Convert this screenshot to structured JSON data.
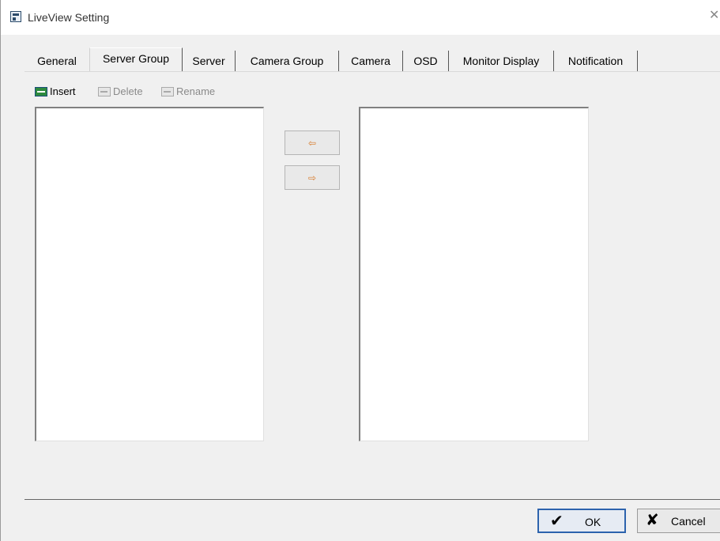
{
  "window": {
    "title": "LiveView Setting"
  },
  "tabs": [
    {
      "label": "General"
    },
    {
      "label": "Server Group",
      "active": true
    },
    {
      "label": "Server"
    },
    {
      "label": "Camera Group"
    },
    {
      "label": "Camera"
    },
    {
      "label": "OSD"
    },
    {
      "label": "Monitor Display"
    },
    {
      "label": "Notification"
    }
  ],
  "toolbar": {
    "insert": {
      "label": "Insert",
      "icon": "insert-icon",
      "enabled": true
    },
    "delete": {
      "label": "Delete",
      "icon": "delete-icon",
      "enabled": false
    },
    "rename": {
      "label": "Rename",
      "icon": "rename-icon",
      "enabled": false
    }
  },
  "transfer": {
    "move_left": {
      "icon": "arrow-left-icon"
    },
    "move_right": {
      "icon": "arrow-right-icon"
    }
  },
  "left_list": {
    "items": []
  },
  "right_list": {
    "items": []
  },
  "footer": {
    "ok_label": "OK",
    "cancel_label": "Cancel"
  },
  "colors": {
    "accent": "#2d63ad",
    "arrow": "#d77b2b",
    "insert_icon": "#2d8a3e"
  }
}
